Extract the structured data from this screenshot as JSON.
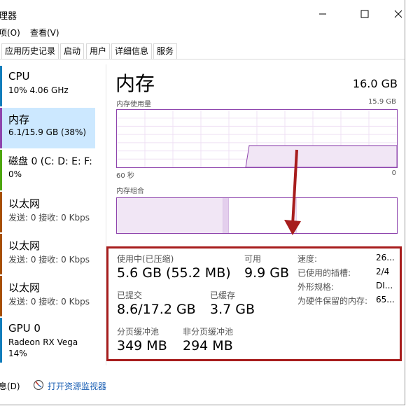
{
  "window": {
    "title": "理器"
  },
  "menu": {
    "options": "项(O)",
    "view": "查看(V)"
  },
  "tabs": [
    "应用历史记录",
    "启动",
    "用户",
    "详细信息",
    "服务"
  ],
  "sidebar": {
    "items": [
      {
        "name": "CPU",
        "value": "10% 4.06 GHz",
        "color": "#117dbb"
      },
      {
        "name": "内存",
        "value": "6.1/15.9 GB (38%)",
        "color": "#8e44ad"
      },
      {
        "name": "磁盘 0 (C: D: E: F:",
        "value": "0%",
        "color": "#4da60c"
      },
      {
        "name": "以太网",
        "value": "发送: 0 接收: 0 Kbps",
        "color": "#a74f01"
      },
      {
        "name": "以太网",
        "value": "发送: 0 接收: 0 Kbps",
        "color": "#a74f01"
      },
      {
        "name": "以太网",
        "value": "发送: 0 接收: 0 Kbps",
        "color": "#a74f01"
      },
      {
        "name": "GPU 0",
        "value": "Radeon RX Vega\n14%",
        "value_line1": "Radeon RX Vega",
        "value_line2": "14%",
        "color": "#117dbb"
      }
    ]
  },
  "main": {
    "heading": "内存",
    "total": "16.0 GB",
    "usage_label": "内存使用量",
    "usage_max": "15.9 GB",
    "time_left": "60 秒",
    "time_right": "0",
    "usage_level": 0.38,
    "composition_label": "内存组合",
    "composition_in_use": 0.38,
    "composition_modified": 0.02,
    "composition_standby": 0.24
  },
  "stats": {
    "in_use_label": "使用中(已压缩)",
    "in_use_value": "5.6 GB (55.2 MB)",
    "available_label": "可用",
    "available_value": "9.9 GB",
    "committed_label": "已提交",
    "committed_value": "8.6/17.2 GB",
    "cached_label": "已缓存",
    "cached_value": "3.7 GB",
    "paged_label": "分页缓冲池",
    "paged_value": "349 MB",
    "nonpaged_label": "非分页缓冲池",
    "nonpaged_value": "294 MB",
    "details": [
      {
        "key": "速度:",
        "value": "26..."
      },
      {
        "key": "已使用的插槽:",
        "value": "2/4"
      },
      {
        "key": "外形规格:",
        "value": "DI..."
      },
      {
        "key": "为硬件保留的内存:",
        "value": "65..."
      }
    ]
  },
  "footer": {
    "less_details": "息(D)",
    "open_monitor": "打开资源监视器"
  },
  "colors": {
    "memory": "#8e44ad",
    "highlight": "#a71d1d",
    "arrow": "#a71d1d",
    "selected": "#cce8ff"
  }
}
